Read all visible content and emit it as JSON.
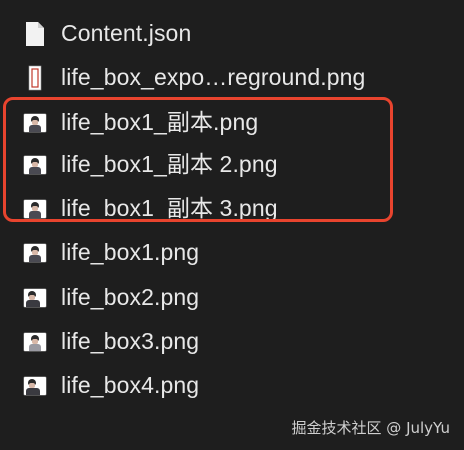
{
  "files": [
    {
      "name": "Content.json",
      "icon": "document-icon"
    },
    {
      "name": "life_box_expo…reground.png",
      "icon": "image-thumbnail-icon"
    },
    {
      "name": "life_box1_副本.png",
      "icon": "image-thumbnail-icon"
    },
    {
      "name": "life_box1_副本 2.png",
      "icon": "image-thumbnail-icon"
    },
    {
      "name": "life_box1_副本 3.png",
      "icon": "image-thumbnail-icon"
    },
    {
      "name": "life_box1.png",
      "icon": "image-thumbnail-icon"
    },
    {
      "name": "life_box2.png",
      "icon": "image-thumbnail-icon"
    },
    {
      "name": "life_box3.png",
      "icon": "image-thumbnail-icon"
    },
    {
      "name": "life_box4.png",
      "icon": "image-thumbnail-icon"
    }
  ],
  "highlight_color": "#e8442e",
  "watermark": "掘金技术社区 @ JulyYu"
}
